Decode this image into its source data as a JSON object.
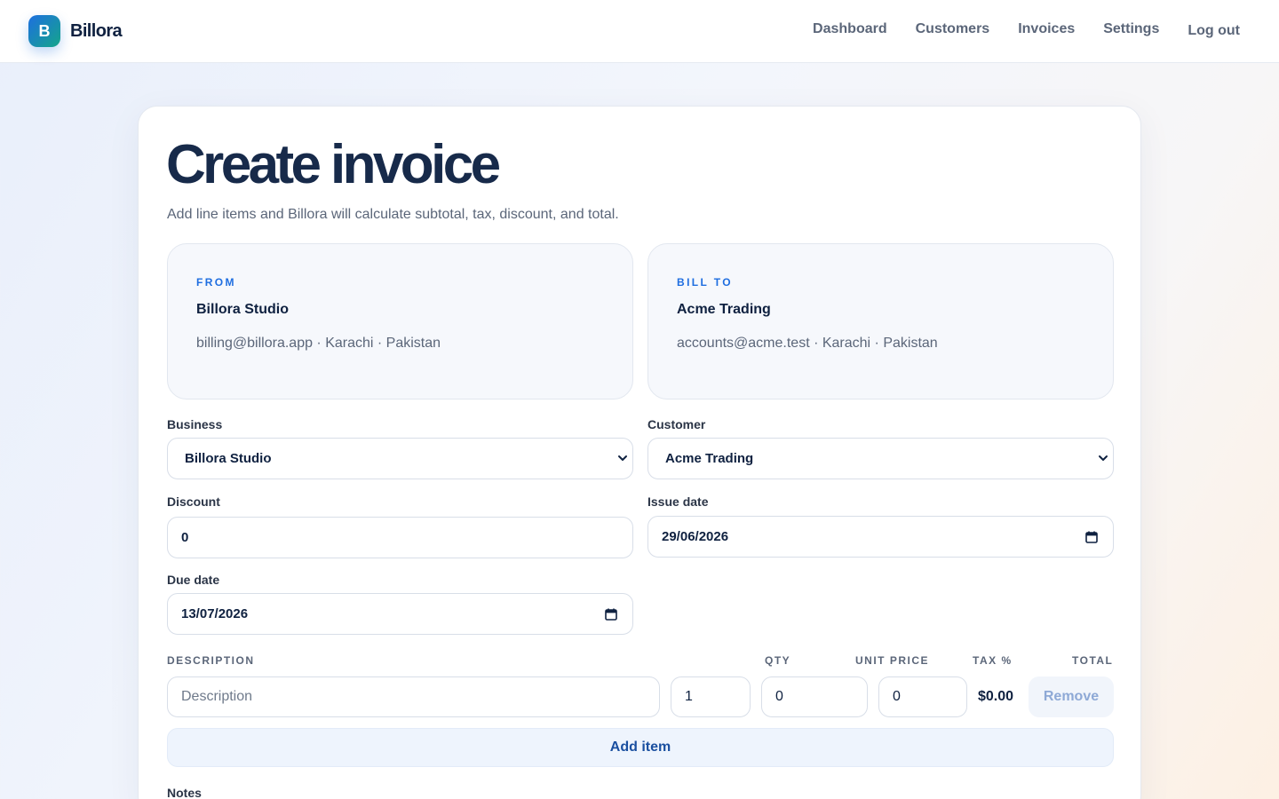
{
  "app": {
    "logo_letter": "B",
    "name": "Billora"
  },
  "nav": [
    "Dashboard",
    "Customers",
    "Invoices",
    "Settings",
    "Log out"
  ],
  "page": {
    "title": "Create invoice",
    "subtitle": "Add line items and Billora will calculate subtotal, tax, discount, and total."
  },
  "from": {
    "label": "FROM",
    "name": "Billora Studio",
    "meta": "billing@billora.app · Karachi · Pakistan"
  },
  "bill_to": {
    "label": "BILL TO",
    "name": "Acme Trading",
    "meta": "accounts@acme.test · Karachi · Pakistan"
  },
  "form": {
    "business": {
      "label": "Business",
      "value": "Billora Studio"
    },
    "customer": {
      "label": "Customer",
      "value": "Acme Trading"
    },
    "discount": {
      "label": "Discount",
      "value": "0"
    },
    "issue_date": {
      "label": "Issue date",
      "value": "29/06/2026"
    },
    "due_date": {
      "label": "Due date",
      "value": "13/07/2026"
    }
  },
  "items": {
    "headers": {
      "description": "DESCRIPTION",
      "qty": "QTY",
      "unit_price": "UNIT PRICE",
      "tax": "TAX %",
      "total": "TOTAL"
    },
    "rows": [
      {
        "description_placeholder": "Description",
        "qty": "1",
        "unit_price": "0",
        "tax": "0",
        "total": "$0.00",
        "remove_label": "Remove"
      }
    ],
    "add_label": "Add item"
  },
  "notes": {
    "label": "Notes"
  },
  "colors": {
    "accent": "#1f6ee0",
    "brand_gradient_start": "#1d6fe0",
    "brand_gradient_end": "#15a58a"
  }
}
